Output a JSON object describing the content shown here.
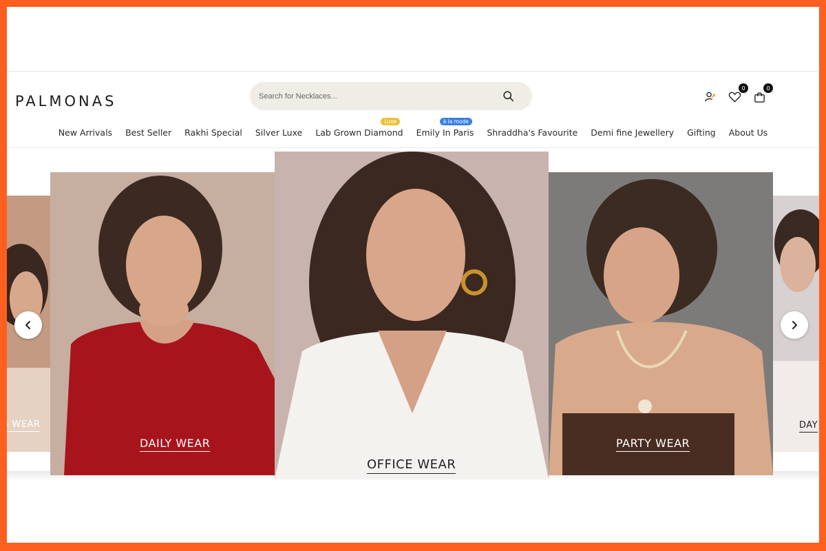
{
  "brand": {
    "logo_text": "PALMONAS",
    "accent": "#ff5f1f"
  },
  "search": {
    "placeholder": "Search for Necklaces...",
    "icon": "search-icon"
  },
  "header_icons": {
    "account_icon": "user-icon",
    "wishlist_icon": "heart-icon",
    "wishlist_count": "0",
    "cart_icon": "shopping-bag-icon",
    "cart_count": "0"
  },
  "nav": {
    "items": [
      {
        "label": "New Arrivals"
      },
      {
        "label": "Best Seller"
      },
      {
        "label": "Rakhi Special"
      },
      {
        "label": "Silver Luxe"
      },
      {
        "label": "Lab Grown Diamond",
        "tag": "Luxe",
        "tag_color": "#e6c23b"
      },
      {
        "label": "Emily In Paris",
        "tag": "à la mode",
        "tag_color": "#3b7fe0"
      },
      {
        "label": "Shraddha's Favourite"
      },
      {
        "label": "Demi fine Jewellery"
      },
      {
        "label": "Gifting"
      },
      {
        "label": "About Us"
      }
    ]
  },
  "carousel": {
    "slides": [
      {
        "label": "S WEAR",
        "bg": "#c9a58f"
      },
      {
        "label": "DAILY WEAR",
        "bg": "#bfa79b"
      },
      {
        "label": "OFFICE WEAR",
        "bg": "#c6b0ab"
      },
      {
        "label": "PARTY WEAR",
        "bg": "#7c7a78"
      },
      {
        "label": "DAY",
        "bg": "#d9d3d4"
      }
    ],
    "prev_icon": "chevron-left-icon",
    "next_icon": "chevron-right-icon"
  }
}
